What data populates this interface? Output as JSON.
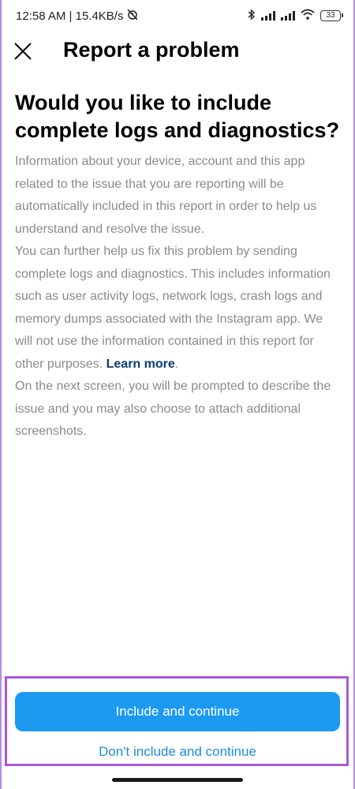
{
  "status_bar": {
    "time_speed": "12:58 AM | 15.4KB/s",
    "battery": "33",
    "icons": [
      "alarm-off-icon",
      "bluetooth-icon",
      "signal-icon",
      "signal-icon",
      "wifi-icon",
      "battery-icon"
    ]
  },
  "header": {
    "title": "Report a problem",
    "close_icon": "close-icon"
  },
  "main": {
    "heading": "Would you like to include complete logs and diagnostics?",
    "paragraph1": "Information about your device, account and this app related to the issue that you are reporting will be automatically included in this report in order to help us understand and resolve the issue.",
    "paragraph2": "You can further help us fix this problem by sending complete logs and diagnostics. This includes information such as user activity logs, network logs, crash logs and memory dumps associated with the Instagram app. We will not use the information contained in this report for other purposes. ",
    "learn_more": "Learn more",
    "period": ".",
    "paragraph3": "On the next screen, you will be prompted to describe the issue and you may also choose to attach additional screenshots."
  },
  "actions": {
    "primary_label": "Include and continue",
    "secondary_label": "Don't include and continue"
  },
  "colors": {
    "primary_button": "#1c9af0",
    "link": "#0a3d73",
    "highlight_border": "#a55bd9"
  }
}
